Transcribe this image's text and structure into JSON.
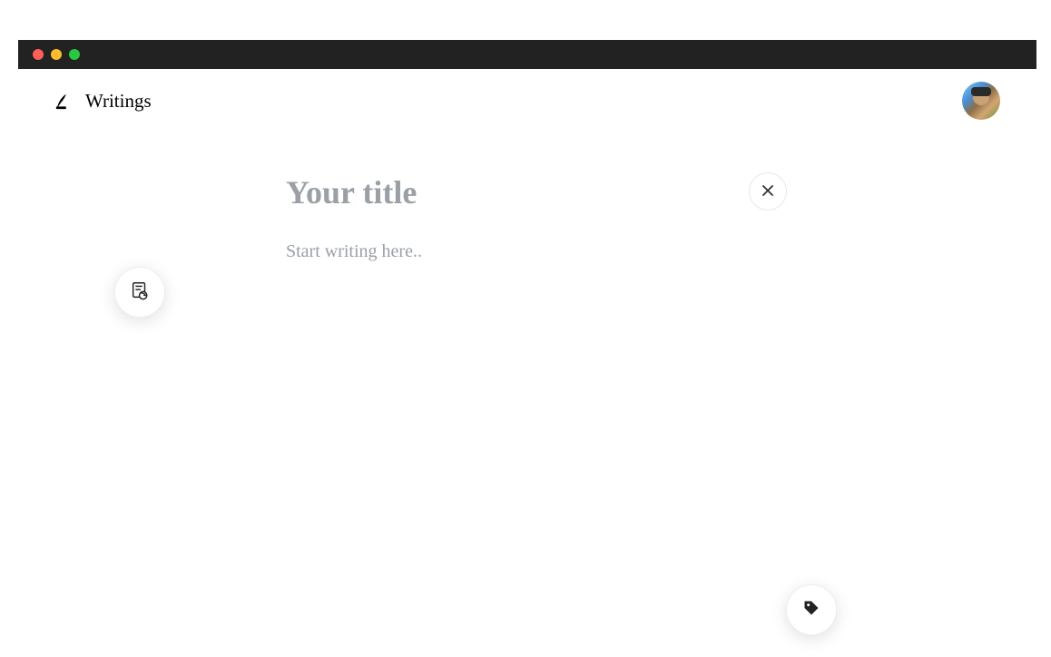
{
  "brand": {
    "name": "Writings"
  },
  "editor": {
    "title_placeholder": "Your title",
    "body_placeholder": "Start writing here..",
    "title_value": "",
    "body_value": ""
  },
  "icons": {
    "quill": "quill-icon",
    "document_history": "document-history-icon",
    "close": "close-icon",
    "tag": "tag-icon"
  },
  "annotation": {
    "highlight_target": "document-history-button",
    "color": "#ff0000"
  }
}
